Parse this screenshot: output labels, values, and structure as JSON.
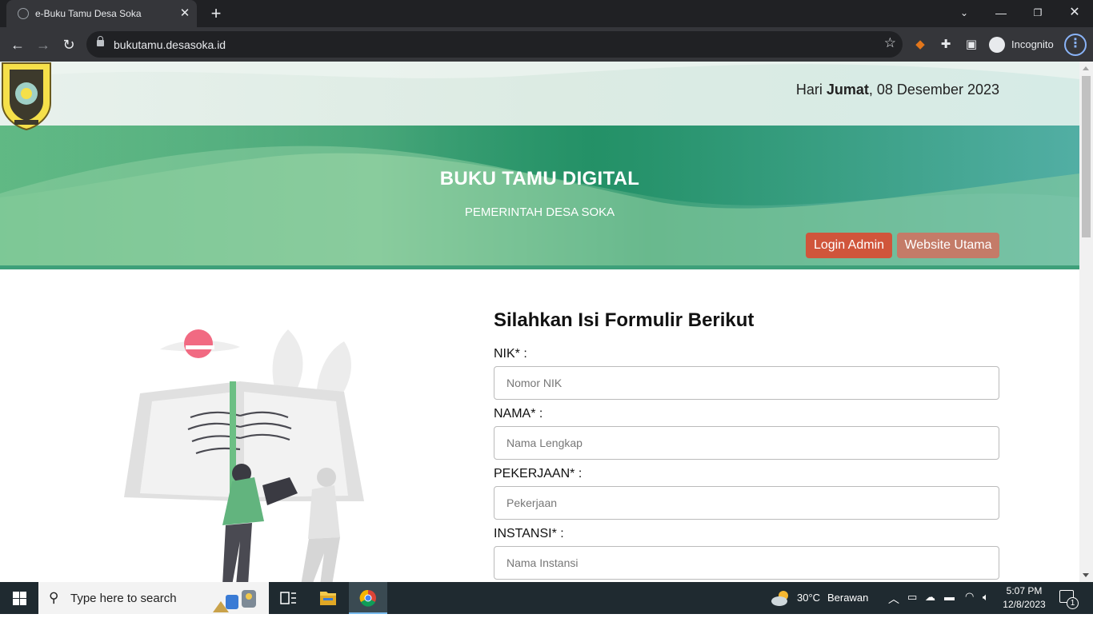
{
  "browser": {
    "tab_title": "e-Buku Tamu Desa Soka",
    "url": "bukutamu.desasoka.id",
    "profile_label": "Incognito"
  },
  "page": {
    "date_prefix": "Hari ",
    "date_day": "Jumat",
    "date_rest": ", 08 Desember 2023",
    "title": "BUKU TAMU DIGITAL",
    "subtitle": "PEMERINTAH DESA SOKA",
    "login_button": "Login Admin",
    "website_button": "Website Utama",
    "form_heading": "Silahkan Isi Formulir Berikut",
    "fields": [
      {
        "label": "NIK* :",
        "placeholder": "Nomor NIK"
      },
      {
        "label": "NAMA* :",
        "placeholder": "Nama Lengkap"
      },
      {
        "label": "PEKERJAAN* :",
        "placeholder": "Pekerjaan"
      },
      {
        "label": "INSTANSI* :",
        "placeholder": "Nama Instansi"
      }
    ],
    "colors": {
      "login_button": "#d0553b",
      "website_button": "#c47b68",
      "hero_green": "#5fba85",
      "hero_teal": "#5fb5b0"
    }
  },
  "taskbar": {
    "search_placeholder": "Type here to search",
    "weather_temp": "30°C",
    "weather_desc": "Berawan",
    "time": "5:07 PM",
    "date": "12/8/2023",
    "notification_count": "1"
  }
}
